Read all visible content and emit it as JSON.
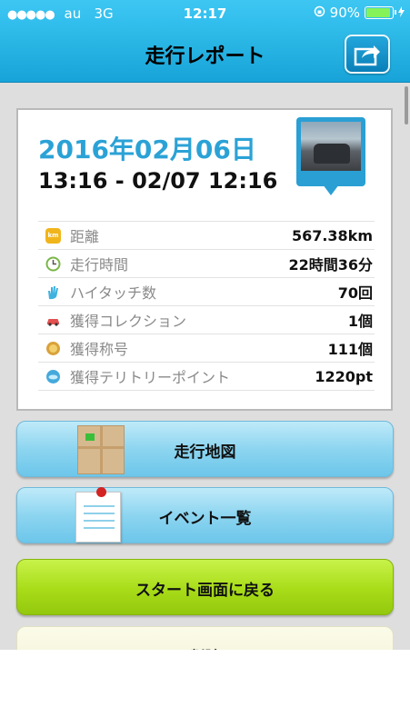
{
  "status_bar": {
    "signal_dots": "●●●●●",
    "carrier": "au",
    "network": "3G",
    "time": "12:17",
    "battery_percent": "90%",
    "battery_level": 0.9
  },
  "nav": {
    "title": "走行レポート",
    "share_icon": "share-icon"
  },
  "report": {
    "date": "2016年02月06日",
    "time_range": "13:16 - 02/07 12:16",
    "stats": [
      {
        "icon": "km-icon",
        "label": "距離",
        "value": "567.38km",
        "color": "#f1b51c",
        "icon_text": "km"
      },
      {
        "icon": "clock-icon",
        "label": "走行時間",
        "value": "22時間36分",
        "color": "#7ab648",
        "icon_text": ""
      },
      {
        "icon": "high-five-icon",
        "label": "ハイタッチ数",
        "value": "70回",
        "color": "#3fb2e0",
        "icon_text": ""
      },
      {
        "icon": "car-icon",
        "label": "獲得コレクション",
        "value": "1個",
        "color": "#e25050",
        "icon_text": ""
      },
      {
        "icon": "medal-icon",
        "label": "獲得称号",
        "value": "111個",
        "color": "#d9a23a",
        "icon_text": ""
      },
      {
        "icon": "point-icon",
        "label": "獲得テリトリーポイント",
        "value": "1220pt",
        "color": "#45a9dc",
        "icon_text": ""
      }
    ]
  },
  "buttons": {
    "map": "走行地図",
    "events": "イベント一覧",
    "back_to_start": "スタート画面に戻る",
    "delete": "削除"
  },
  "colors": {
    "accent_blue": "#2ba2d6",
    "nav_blue": "#17a3d8",
    "green_button": "#a8dc18"
  }
}
